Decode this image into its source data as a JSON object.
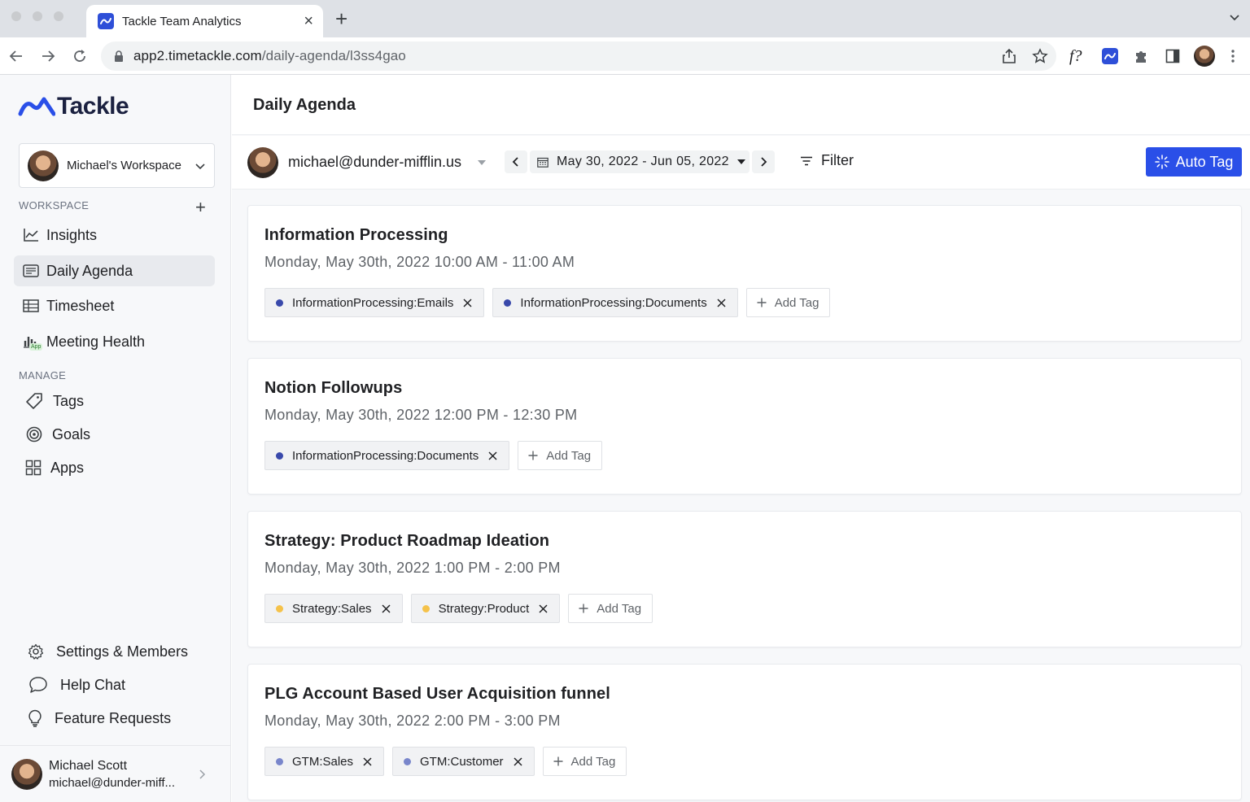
{
  "browser": {
    "tab_title": "Tackle Team Analytics",
    "url_host": "app2.timetackle.com",
    "url_path": "/daily-agenda/l3ss4gao",
    "extension_fx_label": "f?"
  },
  "sidebar": {
    "logo_text": "Tackle",
    "workspace_name": "Michael's Workspace",
    "workspace_label": "WORKSPACE",
    "workspace_items": [
      {
        "label": "Insights",
        "icon": "chart-line-icon"
      },
      {
        "label": "Daily Agenda",
        "icon": "agenda-icon",
        "active": true
      },
      {
        "label": "Timesheet",
        "icon": "table-icon"
      },
      {
        "label": "Meeting Health",
        "icon": "bar-chart-icon",
        "badge": "App"
      }
    ],
    "manage_label": "MANAGE",
    "manage_items": [
      {
        "label": "Tags",
        "icon": "tag-icon"
      },
      {
        "label": "Goals",
        "icon": "target-icon"
      },
      {
        "label": "Apps",
        "icon": "apps-grid-icon"
      }
    ],
    "bottom_items": [
      {
        "label": "Settings & Members",
        "icon": "gear-icon"
      },
      {
        "label": "Help Chat",
        "icon": "chat-bubble-icon"
      },
      {
        "label": "Feature Requests",
        "icon": "lightbulb-icon"
      }
    ],
    "user": {
      "name": "Michael Scott",
      "email": "michael@dunder-miff..."
    }
  },
  "main": {
    "page_title": "Daily Agenda",
    "filter": {
      "user_email": "michael@dunder-mifflin.us",
      "date_range": "May 30, 2022 - Jun 05, 2022",
      "filter_label": "Filter",
      "auto_tag_label": "Auto Tag"
    },
    "add_tag_label": "Add Tag",
    "events": [
      {
        "title": "Information Processing",
        "time": "Monday, May 30th, 2022 10:00 AM - 11:00 AM",
        "tags": [
          {
            "label": "InformationProcessing:Emails",
            "color": "#3949ab"
          },
          {
            "label": "InformationProcessing:Documents",
            "color": "#3949ab"
          }
        ]
      },
      {
        "title": "Notion Followups",
        "time": "Monday, May 30th, 2022 12:00 PM - 12:30 PM",
        "tags": [
          {
            "label": "InformationProcessing:Documents",
            "color": "#3949ab"
          }
        ]
      },
      {
        "title": "Strategy: Product Roadmap Ideation",
        "time": "Monday, May 30th, 2022 1:00 PM - 2:00 PM",
        "tags": [
          {
            "label": "Strategy:Sales",
            "color": "#f5c24a"
          },
          {
            "label": "Strategy:Product",
            "color": "#f5c24a"
          }
        ]
      },
      {
        "title": "PLG Account Based User Acquisition funnel",
        "time": "Monday, May 30th, 2022 2:00 PM - 3:00 PM",
        "tags": [
          {
            "label": "GTM:Sales",
            "color": "#7986cb"
          },
          {
            "label": "GTM:Customer",
            "color": "#7986cb"
          }
        ]
      }
    ]
  }
}
